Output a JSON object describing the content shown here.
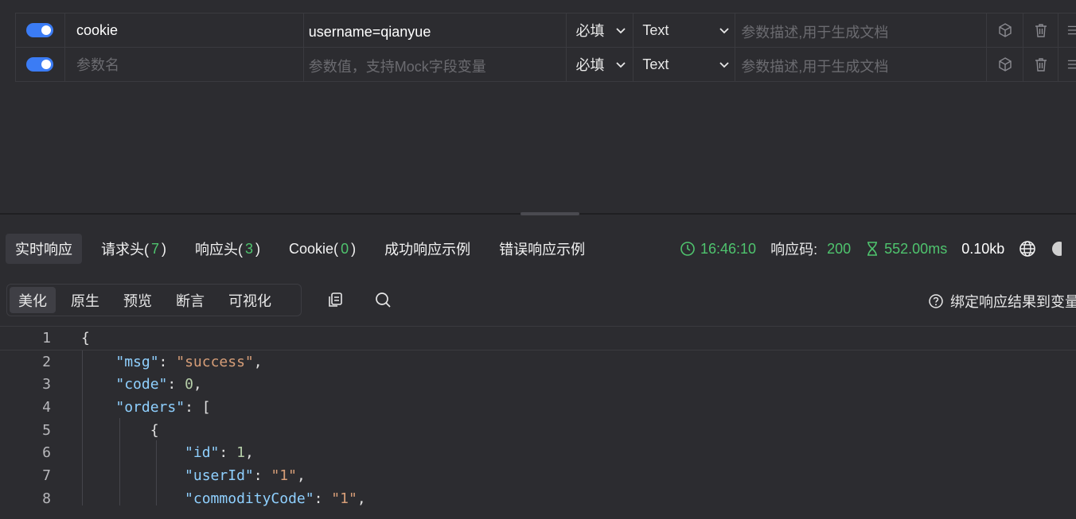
{
  "params": {
    "rows": [
      {
        "enabled": true,
        "name": "cookie",
        "value": "username=qianyue",
        "required": "必填",
        "type": "Text",
        "desc_placeholder": "参数描述,用于生成文档"
      },
      {
        "enabled": true,
        "name_placeholder": "参数名",
        "value_placeholder": "参数值，支持Mock字段变量",
        "required": "必填",
        "type": "Text",
        "desc_placeholder": "参数描述,用于生成文档"
      }
    ]
  },
  "response_tabs": {
    "realtime": "实时响应",
    "req_headers": "请求头(",
    "req_headers_count": "7",
    "resp_headers": "响应头(",
    "resp_headers_count": "3",
    "cookie": "Cookie(",
    "cookie_count": "0",
    "close_paren": ")",
    "success_example": "成功响应示例",
    "error_example": "错误响应示例"
  },
  "response_info": {
    "time": "16:46:10",
    "code_label": "响应码:",
    "code": "200",
    "duration": "552.00ms",
    "size": "0.10kb"
  },
  "view_tabs": [
    "美化",
    "原生",
    "预览",
    "断言",
    "可视化"
  ],
  "bind_label": "绑定响应结果到变量",
  "code_lines": [
    "1",
    "2",
    "3",
    "4",
    "5",
    "6",
    "7",
    "8"
  ],
  "json_text": {
    "open_brace": "{",
    "msg_key": "\"msg\"",
    "msg_val": "\"success\"",
    "code_key": "\"code\"",
    "code_val": "0",
    "orders_key": "\"orders\"",
    "orders_open": "[",
    "obj_open": "{",
    "id_key": "\"id\"",
    "id_val": "1",
    "userId_key": "\"userId\"",
    "userId_val": "\"1\"",
    "commodityCode_key": "\"commodityCode\"",
    "commodityCode_val": "\"1\""
  },
  "colors": {
    "accent_blue": "#3b7cf5",
    "success_green": "#4fc46e",
    "json_key": "#8fd0ff",
    "json_string": "#d79e78"
  },
  "icons": [
    "toggle-switch",
    "chevron-down-icon",
    "cube-icon",
    "trash-icon",
    "menu-icon",
    "clock-icon",
    "hourglass-icon",
    "globe-icon",
    "copy-icon",
    "search-icon",
    "help-circle-icon"
  ]
}
